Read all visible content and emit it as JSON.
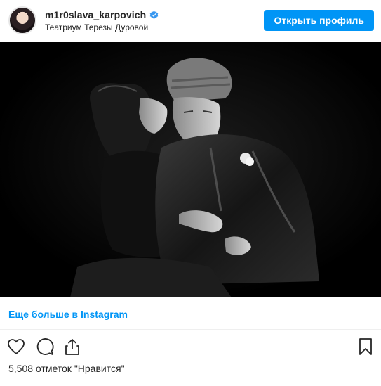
{
  "header": {
    "username": "m1r0slava_karpovich",
    "location": "Театриум Терезы Дуровой",
    "profile_button": "Открыть профиль",
    "verified_icon": "verified-badge-icon"
  },
  "photo": {
    "description_icon": "photo"
  },
  "more": {
    "link_text": "Еще больше в Instagram"
  },
  "actions": {
    "like_icon": "heart-icon",
    "comment_icon": "comment-icon",
    "share_icon": "share-icon",
    "save_icon": "bookmark-icon"
  },
  "likes": {
    "text": "5,508 отметок \"Нравится\""
  },
  "colors": {
    "accent": "#0095f6",
    "text": "#262626",
    "photo_bg": "#000000"
  }
}
